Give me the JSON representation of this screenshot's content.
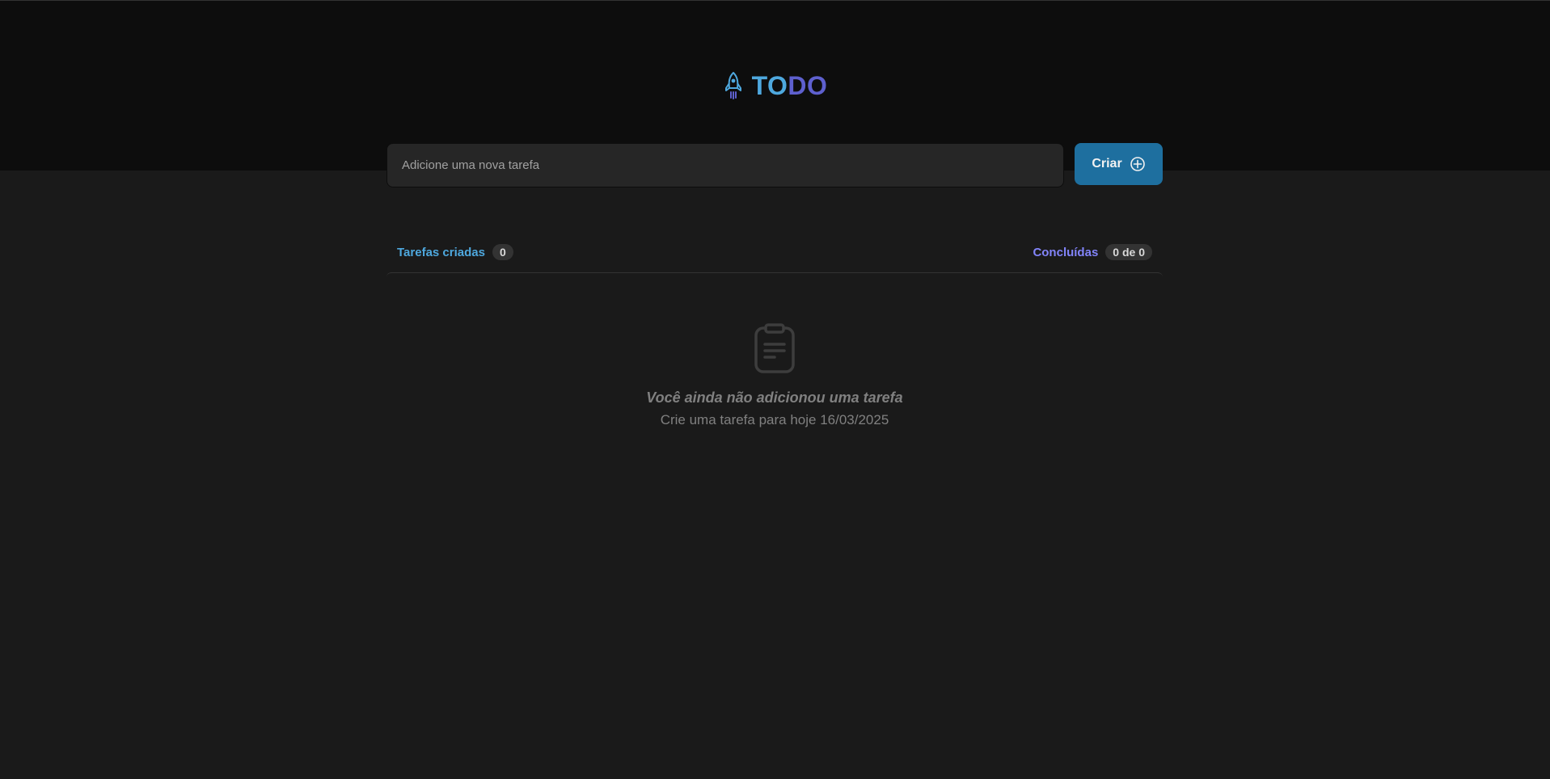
{
  "app": {
    "logo_part1": "TO",
    "logo_part2": "DO",
    "logo_icon": "rocket-icon"
  },
  "create": {
    "placeholder": "Adicione uma nova tarefa",
    "value": "",
    "button_label": "Criar",
    "button_icon": "plus-circle-icon"
  },
  "stats": {
    "created_label": "Tarefas criadas",
    "created_count": "0",
    "done_label": "Concluídas",
    "done_count": "0 de 0"
  },
  "empty": {
    "icon": "clipboard-icon",
    "title": "Você ainda não adicionou uma tarefa",
    "subtitle": "Crie uma tarefa para hoje 16/03/2025"
  },
  "colors": {
    "header_bg": "#0d0d0d",
    "page_bg": "#1a1a1a",
    "blue": "#4ea8de",
    "purple": "#5e60ce",
    "purple_light": "#8284fa",
    "button": "#1e6f9f"
  }
}
